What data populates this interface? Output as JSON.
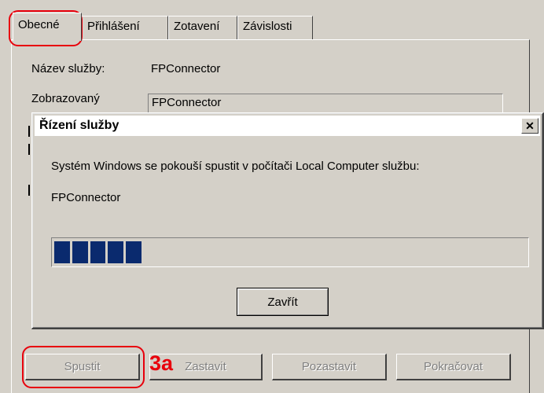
{
  "tabs": [
    {
      "label": "Obecné",
      "active": true
    },
    {
      "label": "Přihlášení",
      "active": false
    },
    {
      "label": "Zotavení",
      "active": false
    },
    {
      "label": "Závislosti",
      "active": false
    }
  ],
  "general": {
    "service_name_label": "Název služby:",
    "service_name_value": "FPConnector",
    "display_name_label": "Zobrazovaný",
    "display_name_value": "FPConnector"
  },
  "buttons": {
    "start": "Spustit",
    "stop": "Zastavit",
    "pause": "Pozastavit",
    "resume": "Pokračovat"
  },
  "annotation": {
    "step_label": "3a",
    "color": "#e8000c"
  },
  "dialog": {
    "title": "Řízení služby",
    "close_glyph": "✕",
    "message": "Systém Windows se pokouší spustit v počítači Local Computer službu:",
    "service": "FPConnector",
    "progress_fraction": 0.19,
    "progress_color": "#0a2a6e",
    "close_button": "Zavřít"
  }
}
